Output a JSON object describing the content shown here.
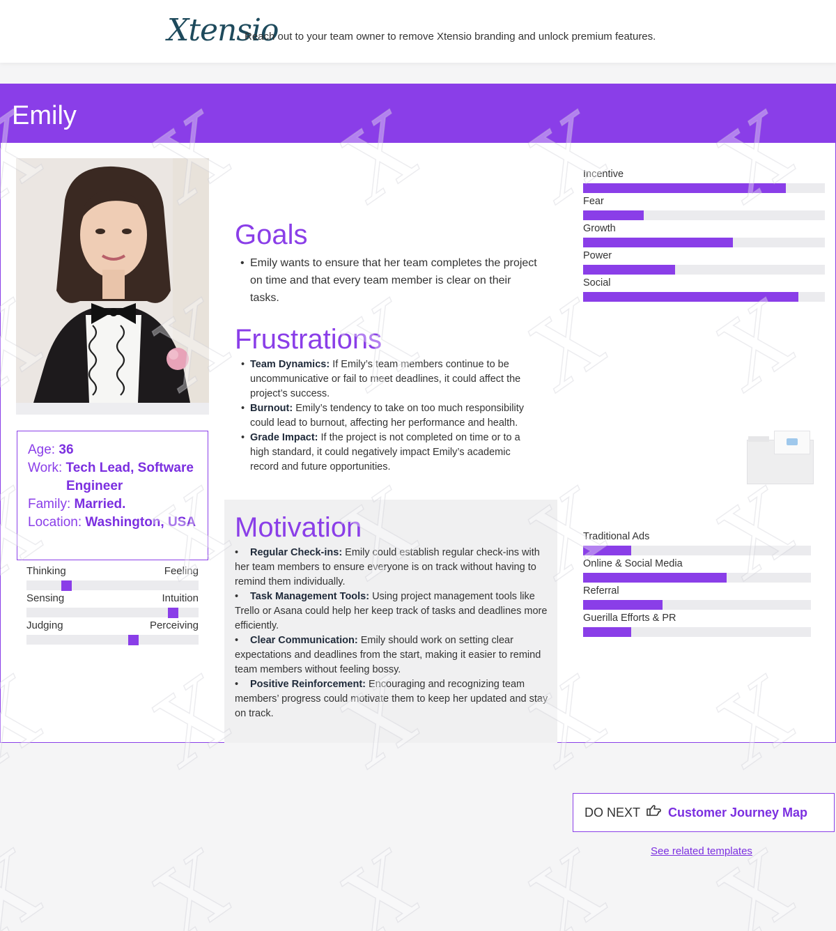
{
  "banner": {
    "logo_text": "Xtensio",
    "message": "Reach out to your team owner to remove Xtensio branding and unlock premium features."
  },
  "persona": {
    "name": "Emily",
    "info": {
      "age_label": "Age:",
      "age": "36",
      "work_label": "Work:",
      "work_line1": "Tech Lead, Software",
      "work_line2": "Engineer",
      "family_label": "Family:",
      "family": "Married.",
      "location_label": "Location:",
      "location": "Washington, USA"
    },
    "personality": [
      {
        "left": "Thinking",
        "right": "Feeling",
        "position": 0.23
      },
      {
        "left": "Sensing",
        "right": "Intuition",
        "position": 0.85
      },
      {
        "left": "Judging",
        "right": "Perceiving",
        "position": 0.62
      }
    ],
    "goals": {
      "title": "Goals",
      "items": [
        "Emily wants to ensure that her team completes the project on time and that every team member is clear on their tasks."
      ]
    },
    "frustrations": {
      "title": "Frustrations",
      "items": [
        {
          "head": "Team Dynamics:",
          "text": " If Emily’s team members continue to be uncommunicative or fail to meet deadlines, it could affect the project’s success."
        },
        {
          "head": "Burnout:",
          "text": " Emily’s tendency to take on too much responsibility could lead to burnout, affecting her performance and health."
        },
        {
          "head": "Grade Impact:",
          "text": " If the project is not completed on time or to a high standard, it could negatively impact Emily’s academic record and future opportunities."
        }
      ]
    },
    "motivation": {
      "title": "Motivation",
      "bullet": "•",
      "items": [
        {
          "head": "Regular Check-ins:",
          "text": " Emily could establish regular check-ins with her team members to ensure everyone is on track without having to remind them individually."
        },
        {
          "head": "Task Management Tools:",
          "text": " Using project management tools like Trello or Asana could help her keep track of tasks and deadlines more efficiently."
        },
        {
          "head": "Clear Communication:",
          "text": " Emily should work on setting clear expectations and deadlines from the start, making it easier to remind team members without feeling bossy."
        },
        {
          "head": "Positive Reinforcement:",
          "text": " Encouraging and recognizing team members’ progress could motivate them to keep her updated and stay on track."
        }
      ]
    },
    "motivation_bars": [
      {
        "label": "Incentive",
        "value": 0.84
      },
      {
        "label": "Fear",
        "value": 0.25
      },
      {
        "label": "Growth",
        "value": 0.62
      },
      {
        "label": "Power",
        "value": 0.38
      },
      {
        "label": "Social",
        "value": 0.89
      }
    ],
    "channel_bars": [
      {
        "label": "Traditional Ads",
        "value": 0.21
      },
      {
        "label": "Online & Social Media",
        "value": 0.63
      },
      {
        "label": "Referral",
        "value": 0.35
      },
      {
        "label": "Guerilla Efforts & PR",
        "value": 0.21
      }
    ]
  },
  "footer": {
    "do_next_label": "DO NEXT",
    "do_next_link": "Customer Journey Map",
    "related_link": "See related templates"
  },
  "colors": {
    "accent": "#8a3ee8",
    "accent_text": "#7b2fe0",
    "track": "#ebebee"
  }
}
